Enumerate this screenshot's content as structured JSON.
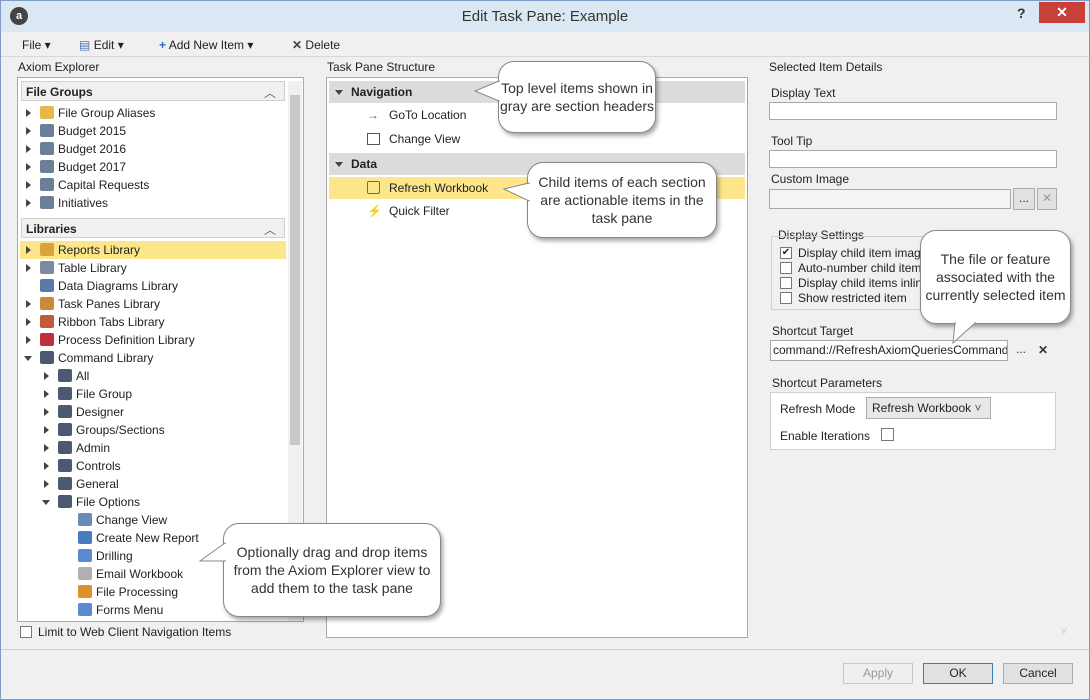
{
  "window": {
    "title": "Edit Task Pane: Example",
    "app_icon": "a",
    "help": "?",
    "close": "✕"
  },
  "menu": {
    "file": "File",
    "edit": "Edit",
    "add_new_item": "Add New Item",
    "delete": "Delete"
  },
  "explorer": {
    "header": "Axiom Explorer",
    "file_groups_header": "File Groups",
    "file_groups": [
      "File Group Aliases",
      "Budget 2015",
      "Budget 2016",
      "Budget 2017",
      "Capital Requests",
      "Initiatives"
    ],
    "libraries_header": "Libraries",
    "libraries": [
      "Reports Library",
      "Table Library",
      "Data Diagrams Library",
      "Task Panes Library",
      "Ribbon Tabs Library",
      "Process Definition Library",
      "Command Library"
    ],
    "command_children": [
      "All",
      "File Group",
      "Designer",
      "Groups/Sections",
      "Admin",
      "Controls",
      "General",
      "File Options"
    ],
    "file_options_children": [
      "Change View",
      "Create New Report",
      "Drilling",
      "Email Workbook",
      "File Processing",
      "Forms Menu"
    ],
    "limit_label": "Limit to Web Client Navigation Items"
  },
  "structure": {
    "header": "Task Pane Structure",
    "sections": [
      {
        "label": "Navigation",
        "items": [
          "GoTo Location",
          "Change View"
        ]
      },
      {
        "label": "Data",
        "items": [
          "Refresh Workbook",
          "Quick Filter"
        ]
      }
    ]
  },
  "details": {
    "header": "Selected Item Details",
    "display_text_label": "Display Text",
    "tooltip_label": "Tool Tip",
    "custom_image_label": "Custom Image",
    "browse": "...",
    "clear": "✕",
    "display_settings_label": "Display Settings",
    "display_settings": [
      {
        "label": "Display child item imag",
        "checked": true
      },
      {
        "label": "Auto-number child item",
        "checked": false
      },
      {
        "label": "Display child items inlin",
        "checked": false
      },
      {
        "label": "Show restricted item",
        "checked": false
      }
    ],
    "shortcut_target_label": "Shortcut Target",
    "shortcut_target_value": "command://RefreshAxiomQueriesCommand",
    "shortcut_params_label": "Shortcut Parameters",
    "refresh_mode_label": "Refresh Mode",
    "refresh_mode_value": "Refresh Workbook",
    "enable_iterations_label": "Enable Iterations"
  },
  "buttons": {
    "apply": "Apply",
    "ok": "OK",
    "cancel": "Cancel"
  },
  "callouts": {
    "top_level": "Top level items shown in gray are section headers",
    "child_items": "Child items of each section are actionable items in the task pane",
    "file_feature": "The file or feature associated with the currently selected item",
    "drag_drop": "Optionally drag and drop items from the Axiom Explorer view to add them to the task pane"
  },
  "colors": {
    "selected": "#fde68a",
    "titlebar": "#dce7f4",
    "close": "#c7413a",
    "section": "#dcdcdc"
  }
}
